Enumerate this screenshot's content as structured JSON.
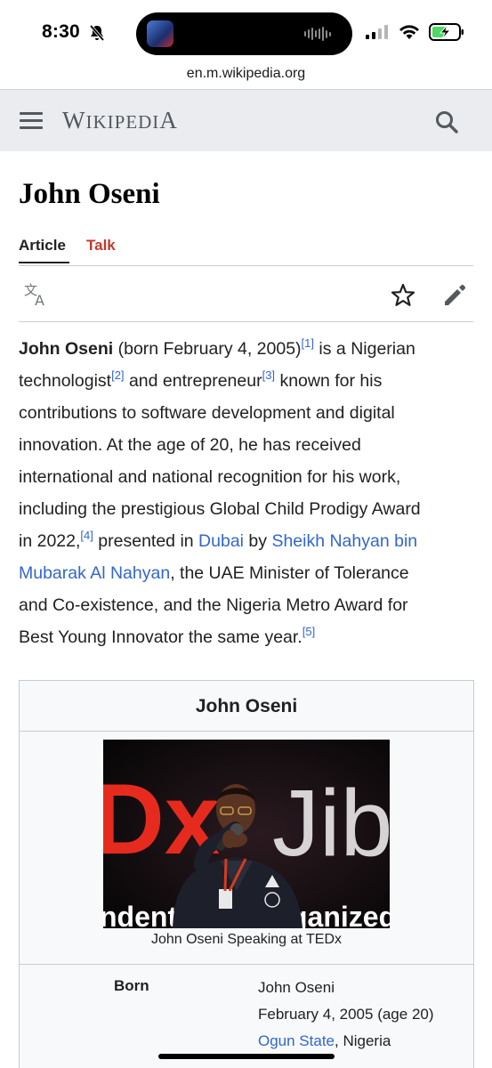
{
  "status_bar": {
    "time": "8:30",
    "icons": [
      "bell-slash-icon",
      "cellular-signal-icon",
      "wifi-icon",
      "battery-charging-icon"
    ],
    "battery_color": "#4cd964"
  },
  "browser": {
    "url": "en.m.wikipedia.org"
  },
  "header": {
    "wordmark": "Wikipedia",
    "menu_icon": "hamburger-menu-icon",
    "search_icon": "search-icon"
  },
  "article": {
    "title": "John Oseni",
    "tabs": [
      {
        "label": "Article",
        "active": true
      },
      {
        "label": "Talk",
        "active": false
      }
    ],
    "tools": [
      "translate-icon",
      "star-icon",
      "edit-icon"
    ],
    "lead": {
      "name": "John Oseni",
      "l1_text": " (born February 4, 2005)",
      "ref1": "[1]",
      "l1_tail": " is a Nigerian",
      "l2_a": "technologist",
      "ref2": "[2]",
      "l2_b": " and entrepreneur",
      "ref3": "[3]",
      "l2_c": " known for his",
      "l3": "contributions to software development and digital",
      "l4": "innovation. At the age of 20, he has received",
      "l5": "international and national recognition for his work,",
      "l6": "including the prestigious Global Child Prodigy Award",
      "l7_a": "in 2022,",
      "ref4": "[4]",
      "l7_b": " presented in ",
      "link_dubai": "Dubai",
      "l7_c": " by ",
      "link_sheikh_a": "Sheikh Nahyan bin",
      "link_sheikh_b": "Mubarak Al Nahyan",
      "l8_tail": ", the UAE Minister of Tolerance",
      "l9": "and Co-existence, and the Nigeria Metro Award for",
      "l10": "Best Young Innovator the same year.",
      "ref5": "[5]"
    }
  },
  "infobox": {
    "title": "John Oseni",
    "image_caption": "John Oseni Speaking at TEDx",
    "image_text": {
      "mark": "Dx",
      "right": "Jib",
      "bottom_a": "ndent",
      "bottom_b": "ganized"
    },
    "born_label": "Born",
    "born_name": "John Oseni",
    "born_date": "February 4, 2005 (age 20)",
    "born_place_link": "Ogun State",
    "born_place_rest": ", Nigeria"
  },
  "colors": {
    "link": "#3366cc",
    "talk_tab": "#bf3c2c",
    "header_bg": "#eaecf0",
    "ted_red": "#e62b1e"
  }
}
